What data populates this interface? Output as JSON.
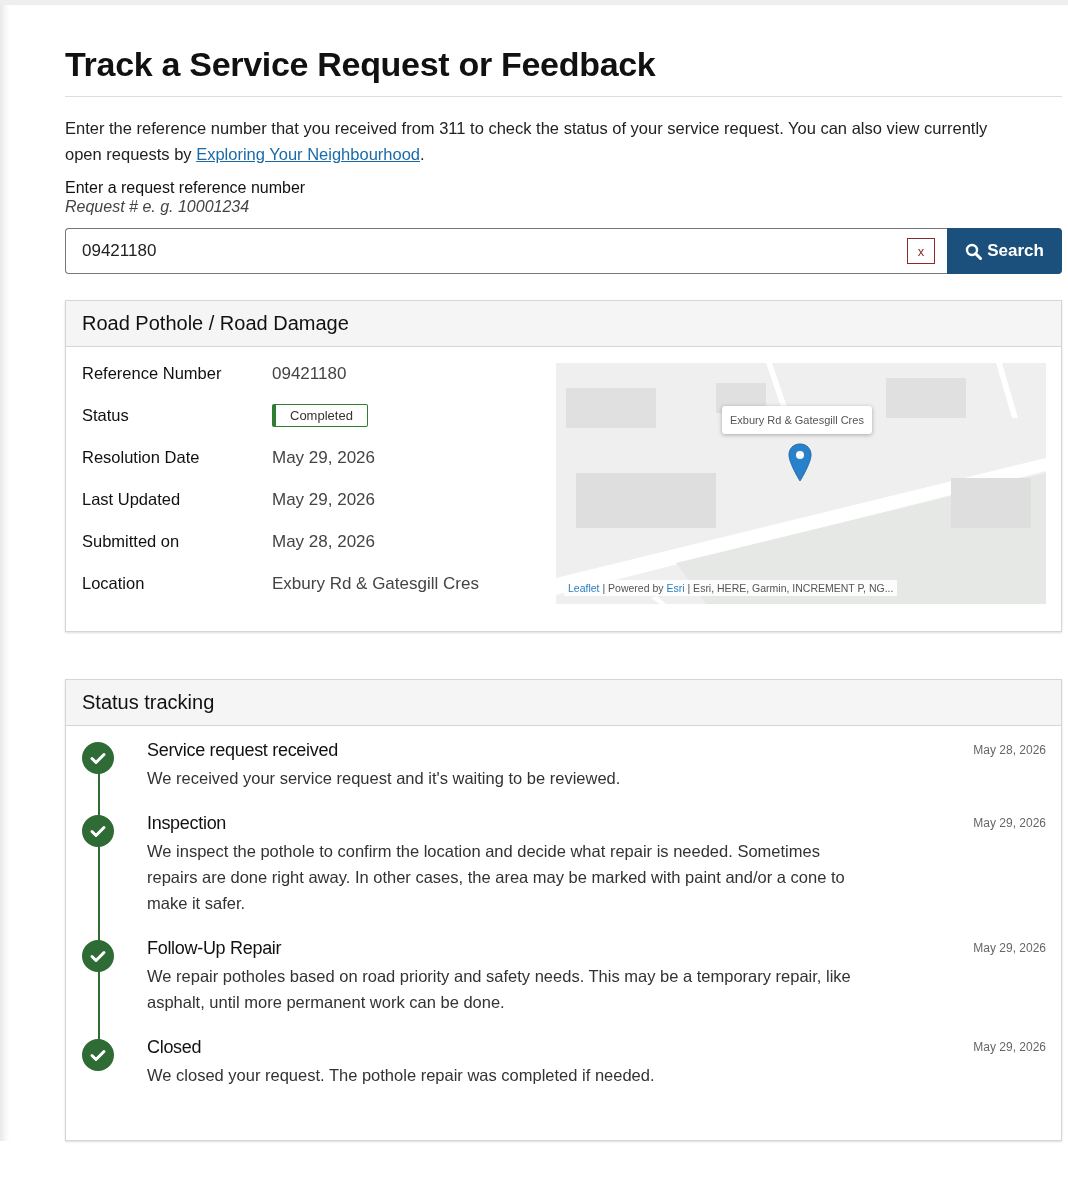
{
  "page": {
    "title": "Track a Service Request or Feedback",
    "intro": "Enter the reference number that you received from 311 to check the status of your service request. You can also view currently open requests by",
    "intro_link": "Exploring Your Neighbourhood",
    "intro_end": "."
  },
  "search": {
    "label": "Enter a request reference number",
    "hint": "Request # e. g. 10001234",
    "value": "09421180",
    "clear_label": "x",
    "button": "Search"
  },
  "request": {
    "title": "Road Pothole / Road Damage",
    "fields": [
      {
        "label": "Reference Number",
        "value": "09421180",
        "kind": "text"
      },
      {
        "label": "Status",
        "value": "Completed",
        "kind": "badge"
      },
      {
        "label": "Resolution Date",
        "value": "May 29, 2026",
        "kind": "text"
      },
      {
        "label": "Last Updated",
        "value": "May 29, 2026",
        "kind": "text"
      },
      {
        "label": "Submitted on",
        "value": "May 28, 2026",
        "kind": "text"
      },
      {
        "label": "Location",
        "value": "Exbury Rd & Gatesgill Cres",
        "kind": "text"
      }
    ],
    "map": {
      "kind": "picture",
      "popup": "Exbury Rd & Gatesgill Cres",
      "attribution": [
        {
          "text": "Leaflet",
          "kind": "link"
        },
        {
          "text": " | Powered by ",
          "kind": "text"
        },
        {
          "text": "Esri",
          "kind": "link"
        },
        {
          "text": " | Esri, HERE, Garmin, INCREMENT P, NG...",
          "kind": "text"
        }
      ]
    }
  },
  "tracking": {
    "title": "Status tracking",
    "steps": [
      {
        "title": "Service request received",
        "description": "We received your service request and it's waiting to be reviewed.",
        "date": "May 28, 2026",
        "completed": true
      },
      {
        "title": "Inspection",
        "description": "We inspect the pothole to confirm the location and decide what repair is needed. Sometimes repairs are done right away. In other cases, the area may be marked with paint and/or a cone to make it safer.",
        "date": "May 29, 2026",
        "completed": true
      },
      {
        "title": "Follow-Up Repair",
        "description": "We repair potholes based on road priority and safety needs. This may be a temporary repair, like asphalt, until more permanent work can be done.",
        "date": "May 29, 2026",
        "completed": true
      },
      {
        "title": "Closed",
        "description": "We closed your request. The pothole repair was completed if needed.",
        "date": "May 29, 2026",
        "completed": true
      }
    ]
  }
}
